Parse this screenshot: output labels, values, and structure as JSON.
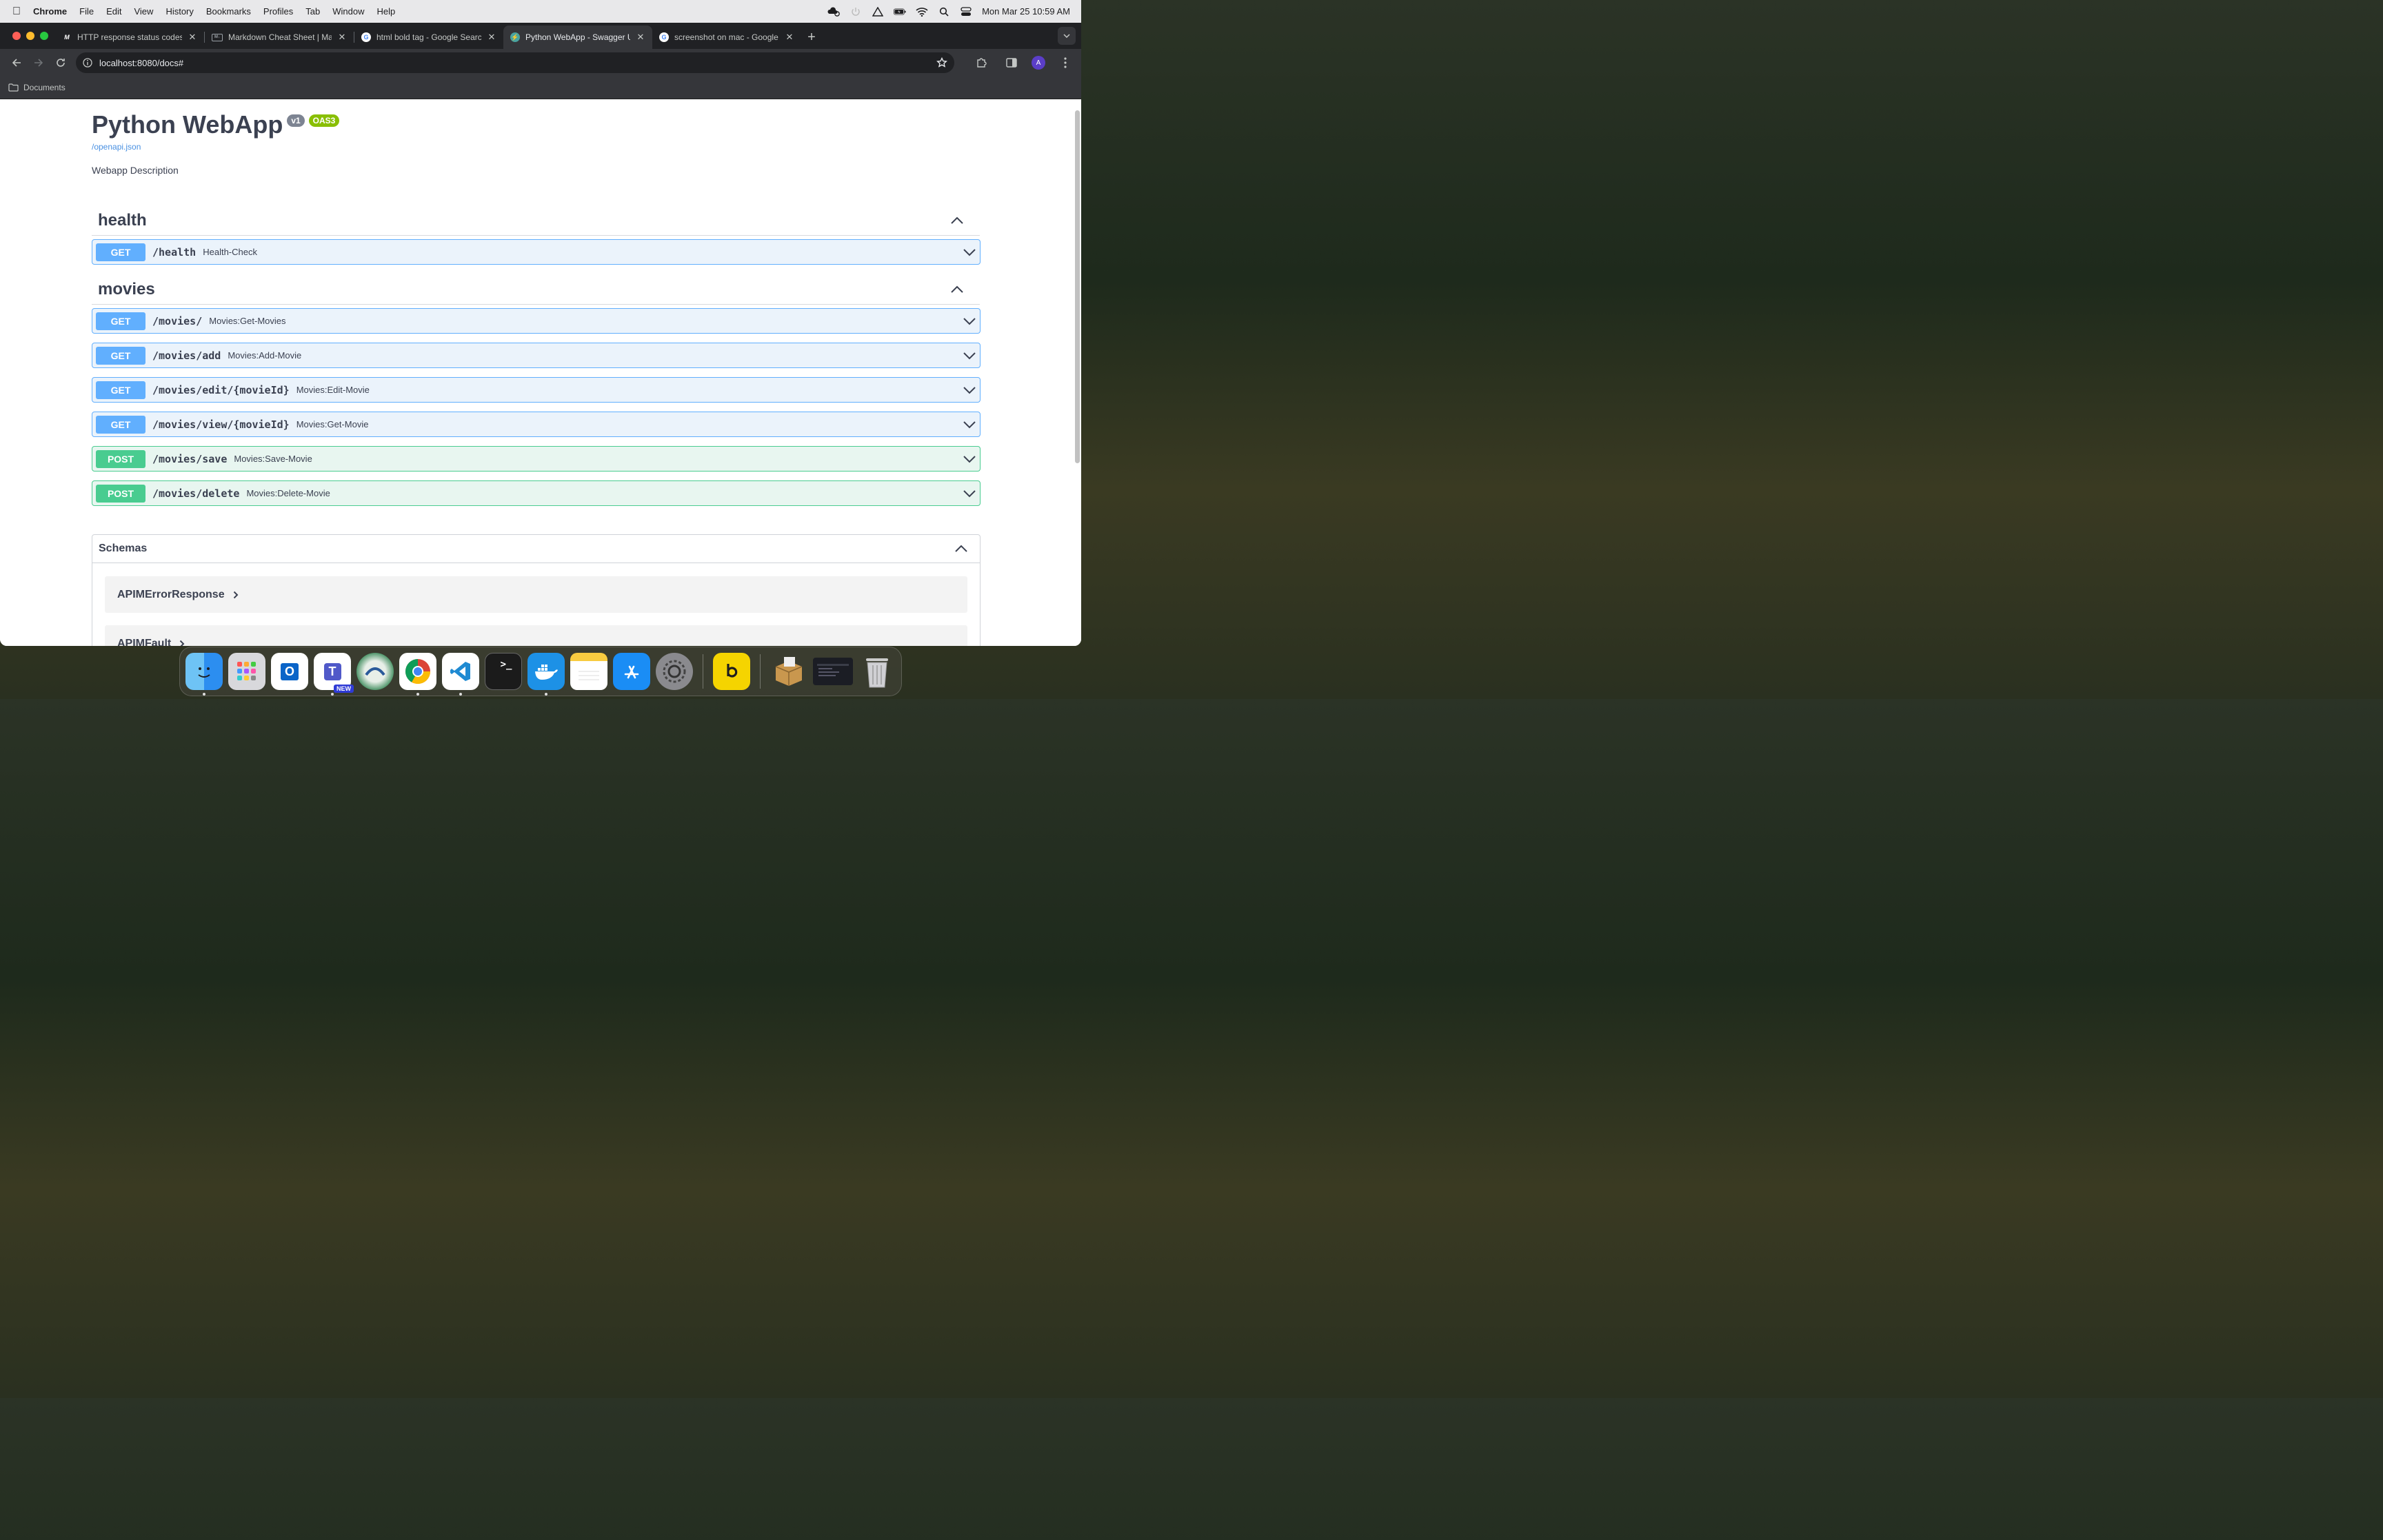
{
  "menubar": {
    "app_name": "Chrome",
    "menus": [
      "File",
      "Edit",
      "View",
      "History",
      "Bookmarks",
      "Profiles",
      "Tab",
      "Window",
      "Help"
    ],
    "clock": "Mon Mar 25  10:59 AM"
  },
  "browser": {
    "tabs": [
      {
        "title": "HTTP response status codes",
        "favicon": "mdn-icon",
        "active": false
      },
      {
        "title": "Markdown Cheat Sheet | Mark",
        "favicon": "markdown-icon",
        "active": false
      },
      {
        "title": "html bold tag - Google Search",
        "favicon": "google-icon",
        "active": false
      },
      {
        "title": "Python WebApp - Swagger UI",
        "favicon": "swagger-icon",
        "active": true
      },
      {
        "title": "screenshot on mac - Google S",
        "favicon": "google-icon",
        "active": false
      }
    ],
    "url": "localhost:8080/docs#",
    "profile_initial": "A",
    "bookmarks": [
      "Documents"
    ]
  },
  "swagger": {
    "title": "Python WebApp",
    "version_badge": "v1",
    "oas_badge": "OAS3",
    "spec_link": "/openapi.json",
    "description": "Webapp Description",
    "sections": [
      {
        "tag": "health",
        "operations": [
          {
            "method": "GET",
            "path": "/health",
            "summary": "Health-Check"
          }
        ]
      },
      {
        "tag": "movies",
        "operations": [
          {
            "method": "GET",
            "path": "/movies/",
            "summary": "Movies:Get-Movies"
          },
          {
            "method": "GET",
            "path": "/movies/add",
            "summary": "Movies:Add-Movie"
          },
          {
            "method": "GET",
            "path": "/movies/edit/{movieId}",
            "summary": "Movies:Edit-Movie"
          },
          {
            "method": "GET",
            "path": "/movies/view/{movieId}",
            "summary": "Movies:Get-Movie"
          },
          {
            "method": "POST",
            "path": "/movies/save",
            "summary": "Movies:Save-Movie"
          },
          {
            "method": "POST",
            "path": "/movies/delete",
            "summary": "Movies:Delete-Movie"
          }
        ]
      }
    ],
    "schemas_title": "Schemas",
    "schemas": [
      "APIMErrorResponse",
      "APIMFault"
    ]
  },
  "dock": {
    "apps": [
      "Finder",
      "Launchpad",
      "Outlook",
      "Teams",
      "Citrix",
      "Chrome",
      "VS Code",
      "Terminal",
      "Docker",
      "Notes",
      "App Store",
      "System Settings",
      "Bezel",
      "Installer",
      "Screenshot",
      "Trash"
    ],
    "teams_badge": "NEW"
  },
  "colors": {
    "get": "#61affe",
    "post": "#49cc90",
    "title": "#3b4151",
    "link": "#4990e2"
  }
}
